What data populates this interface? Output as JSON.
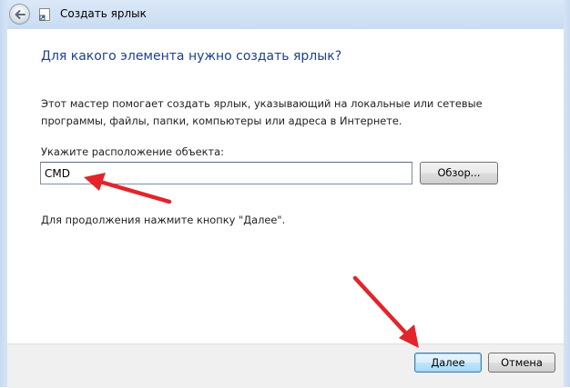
{
  "window": {
    "title": "Создать ярлык"
  },
  "main": {
    "heading": "Для какого элемента нужно создать ярлык?",
    "description": "Этот мастер помогает создать ярлык, указывающий на локальные или сетевые программы, файлы, папки, компьютеры или адреса в Интернете.",
    "location_label": "Укажите расположение объекта:",
    "location_value": "CMD",
    "browse_label": "Обзор...",
    "hint": "Для продолжения нажмите кнопку \"Далее\"."
  },
  "footer": {
    "next_label": "Далее",
    "cancel_label": "Отмена"
  },
  "colors": {
    "heading": "#1c3f95",
    "annotation_arrow": "#e3242b",
    "title_bar": "#c9dcf1"
  },
  "icons": [
    "back-arrow-icon",
    "shortcut-wizard-icon"
  ]
}
